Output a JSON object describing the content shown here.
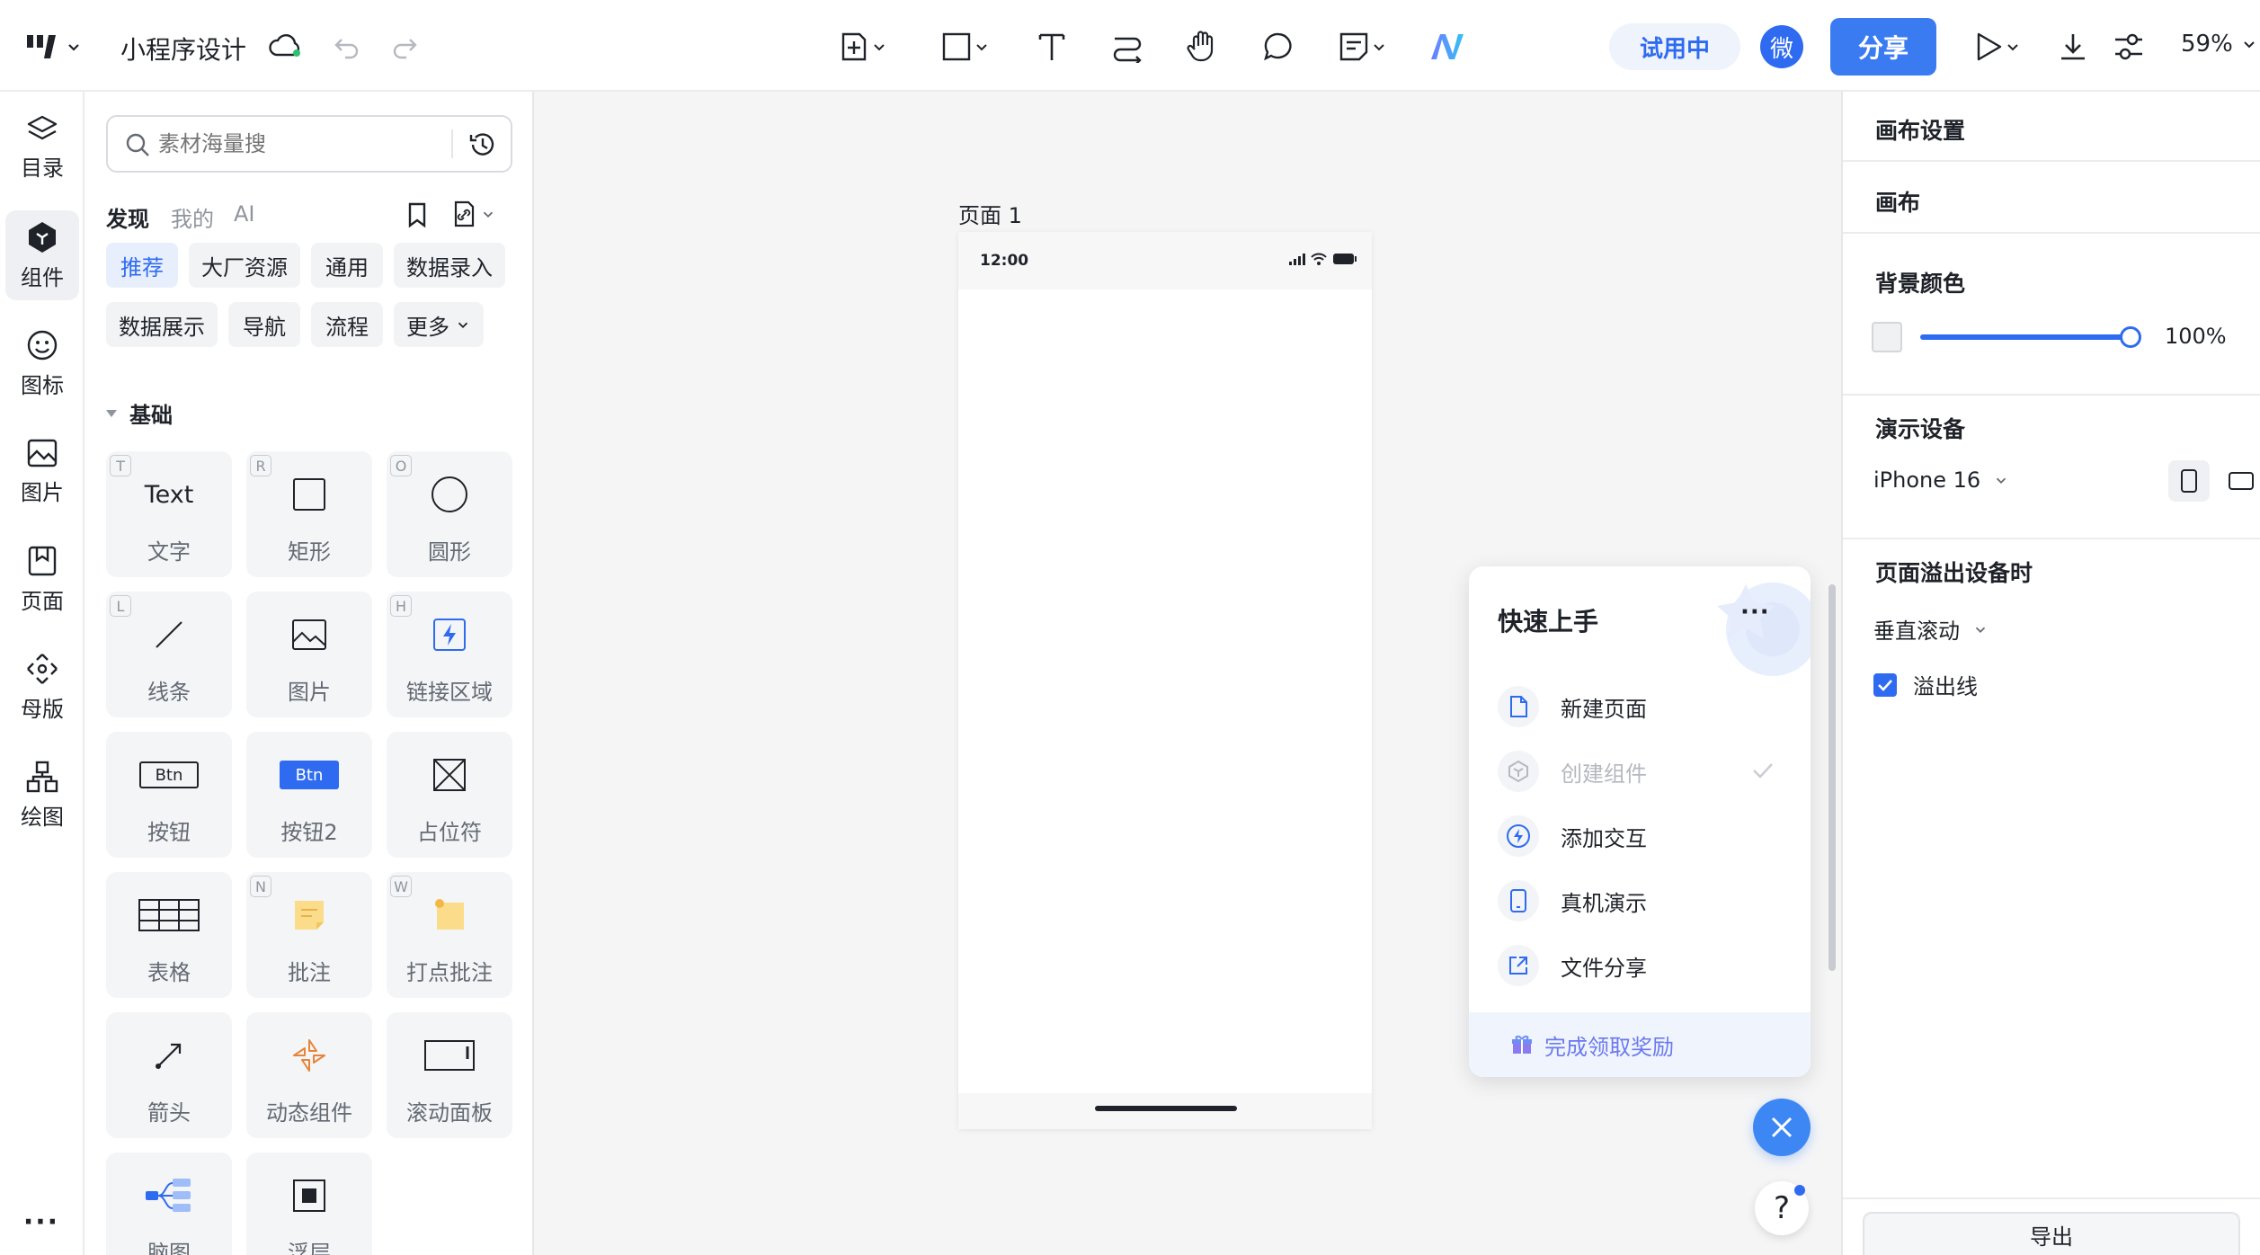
{
  "app": {
    "title": "小程序设计",
    "trial_label": "试用中",
    "avatar_char": "微",
    "share_label": "分享",
    "zoom": "59%"
  },
  "rail": {
    "items": [
      {
        "label": "目录",
        "icon": "layers-icon"
      },
      {
        "label": "组件",
        "icon": "component-cube-icon"
      },
      {
        "label": "图标",
        "icon": "smiley-icon"
      },
      {
        "label": "图片",
        "icon": "image-icon"
      },
      {
        "label": "页面",
        "icon": "page-bookmark-icon"
      },
      {
        "label": "母版",
        "icon": "master-diamond-icon"
      },
      {
        "label": "绘图",
        "icon": "shapes-icon"
      }
    ],
    "more": "···"
  },
  "panel": {
    "search_placeholder": "素材海量搜",
    "tabs": [
      "发现",
      "我的",
      "AI"
    ],
    "chips": [
      "推荐",
      "大厂资源",
      "通用",
      "数据录入",
      "数据展示",
      "导航",
      "流程",
      "更多"
    ],
    "section_title": "基础",
    "text_tile_glyph": "Text",
    "btn_glyph": "Btn",
    "tiles": [
      {
        "label": "文字",
        "key": "T"
      },
      {
        "label": "矩形",
        "key": "R"
      },
      {
        "label": "圆形",
        "key": "O"
      },
      {
        "label": "线条",
        "key": "L"
      },
      {
        "label": "图片",
        "key": ""
      },
      {
        "label": "链接区域",
        "key": "H"
      },
      {
        "label": "按钮",
        "key": ""
      },
      {
        "label": "按钮2",
        "key": ""
      },
      {
        "label": "占位符",
        "key": ""
      },
      {
        "label": "表格",
        "key": ""
      },
      {
        "label": "批注",
        "key": "N"
      },
      {
        "label": "打点批注",
        "key": "W"
      },
      {
        "label": "箭头",
        "key": ""
      },
      {
        "label": "动态组件",
        "key": ""
      },
      {
        "label": "滚动面板",
        "key": ""
      },
      {
        "label": "脑图",
        "key": ""
      },
      {
        "label": "浮层",
        "key": ""
      }
    ]
  },
  "canvas": {
    "page_label": "页面 1",
    "status_time": "12:00"
  },
  "right_panel": {
    "canvas_settings": "画布设置",
    "canvas_label": "画布",
    "bg_color_label": "背景颜色",
    "bg_opacity": "100%",
    "bg_opacity_fraction": 1.0,
    "device_label": "演示设备",
    "device_value": "iPhone 16",
    "overflow_label": "页面溢出设备时",
    "scroll_value": "垂直滚动",
    "overflow_line_label": "溢出线",
    "overflow_line_checked": true,
    "export_label": "导出"
  },
  "quickstart": {
    "title": "快速上手",
    "more": "···",
    "items": [
      {
        "label": "新建页面",
        "icon": "document-icon",
        "done": false
      },
      {
        "label": "创建组件",
        "icon": "component-hex-icon",
        "done": true
      },
      {
        "label": "添加交互",
        "icon": "lightning-icon",
        "done": false
      },
      {
        "label": "真机演示",
        "icon": "phone-icon",
        "done": false
      },
      {
        "label": "文件分享",
        "icon": "share-out-icon",
        "done": false
      }
    ],
    "reward": "完成领取奖励"
  },
  "help_label": "?",
  "colors": {
    "accent": "#2f6bf0",
    "share_bg": "#3a7bf2",
    "trial_bg": "#eef3fc",
    "close_btn": "#3d87f5"
  }
}
